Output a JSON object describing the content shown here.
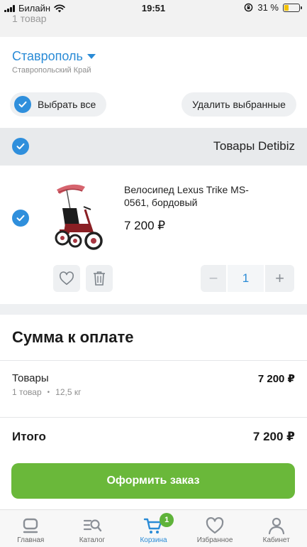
{
  "status_bar": {
    "carrier": "Билайн",
    "time": "19:51",
    "battery": "31 %",
    "battery_level": 0.31
  },
  "header": {
    "item_count": "1 товар"
  },
  "location": {
    "city": "Ставрополь",
    "region": "Ставропольский Край"
  },
  "actions": {
    "select_all": "Выбрать все",
    "delete_selected": "Удалить выбранные"
  },
  "store": {
    "name": "Товары Detibiz"
  },
  "product": {
    "title": "Велосипед Lexus Trike MS-0561, бордовый",
    "price": "7 200 ₽",
    "quantity": "1",
    "minus": "−",
    "plus": "+"
  },
  "summary": {
    "title": "Сумма к оплате",
    "goods_label": "Товары",
    "goods_value": "7 200 ₽",
    "goods_count": "1 товар",
    "bullet": "•",
    "weight": "12,5 кг",
    "total_label": "Итого",
    "total_value": "7 200 ₽"
  },
  "order_button": "Оформить заказ",
  "tabs": [
    {
      "label": "Главная",
      "icon": "home-icon"
    },
    {
      "label": "Каталог",
      "icon": "catalog-search-icon"
    },
    {
      "label": "Корзина",
      "icon": "cart-icon",
      "active": true,
      "badge": "1"
    },
    {
      "label": "Избранное",
      "icon": "heart-icon"
    },
    {
      "label": "Кабинет",
      "icon": "user-icon"
    }
  ],
  "colors": {
    "accent": "#2a8bd6",
    "check": "#2f8fdc",
    "order_button": "#6ab83a",
    "badge": "#5fb33a"
  }
}
